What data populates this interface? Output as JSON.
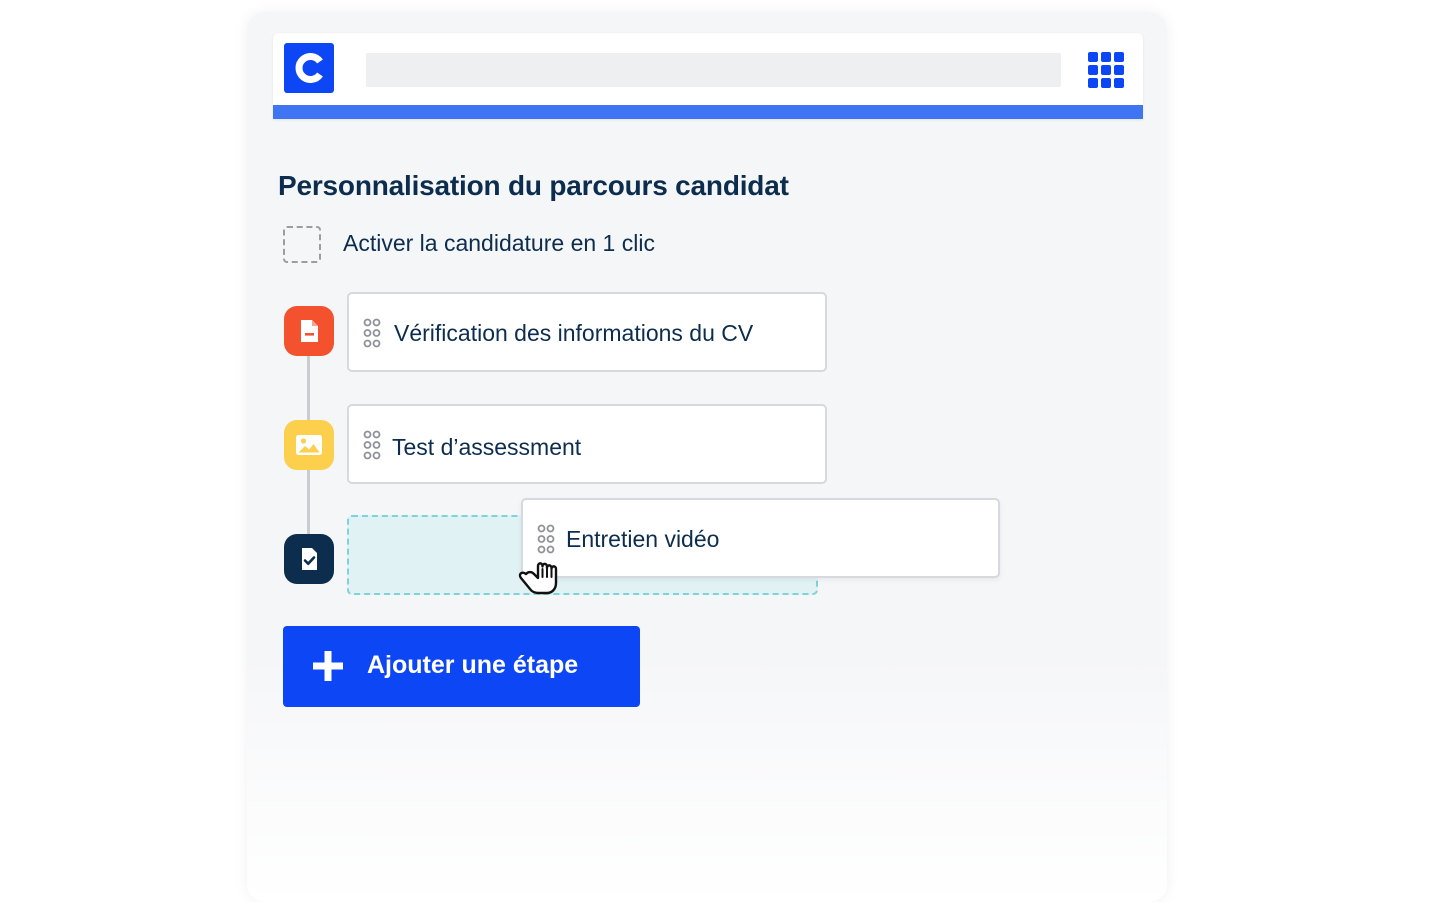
{
  "colors": {
    "brand_blue": "#0d47f5",
    "accent_bar": "#3f74f2",
    "title_navy": "#0c2d4d",
    "step_cv": "#f4522f",
    "step_test": "#fccf4d",
    "step_video": "#0c2d4d",
    "dropzone_fill": "#e1f2f4",
    "dropzone_border": "#7dd3d7"
  },
  "header": {
    "logo_icon": "c-logo-icon",
    "apps_icon": "grid-apps-icon"
  },
  "page": {
    "title": "Personnalisation du parcours candidat"
  },
  "one_click": {
    "label": "Activer la candidature en 1 clic",
    "checked": false
  },
  "steps": [
    {
      "label": "Vérification des informations du CV",
      "icon": "document-icon"
    },
    {
      "label": "Test d’assessment",
      "icon": "image-icon"
    },
    {
      "label": "Entretien vidéo",
      "icon": "document-check-icon",
      "dragging": true
    }
  ],
  "actions": {
    "add_step_label": "Ajouter une étape",
    "add_icon": "plus-icon"
  },
  "cursor": {
    "icon": "grab-hand-cursor-icon"
  }
}
